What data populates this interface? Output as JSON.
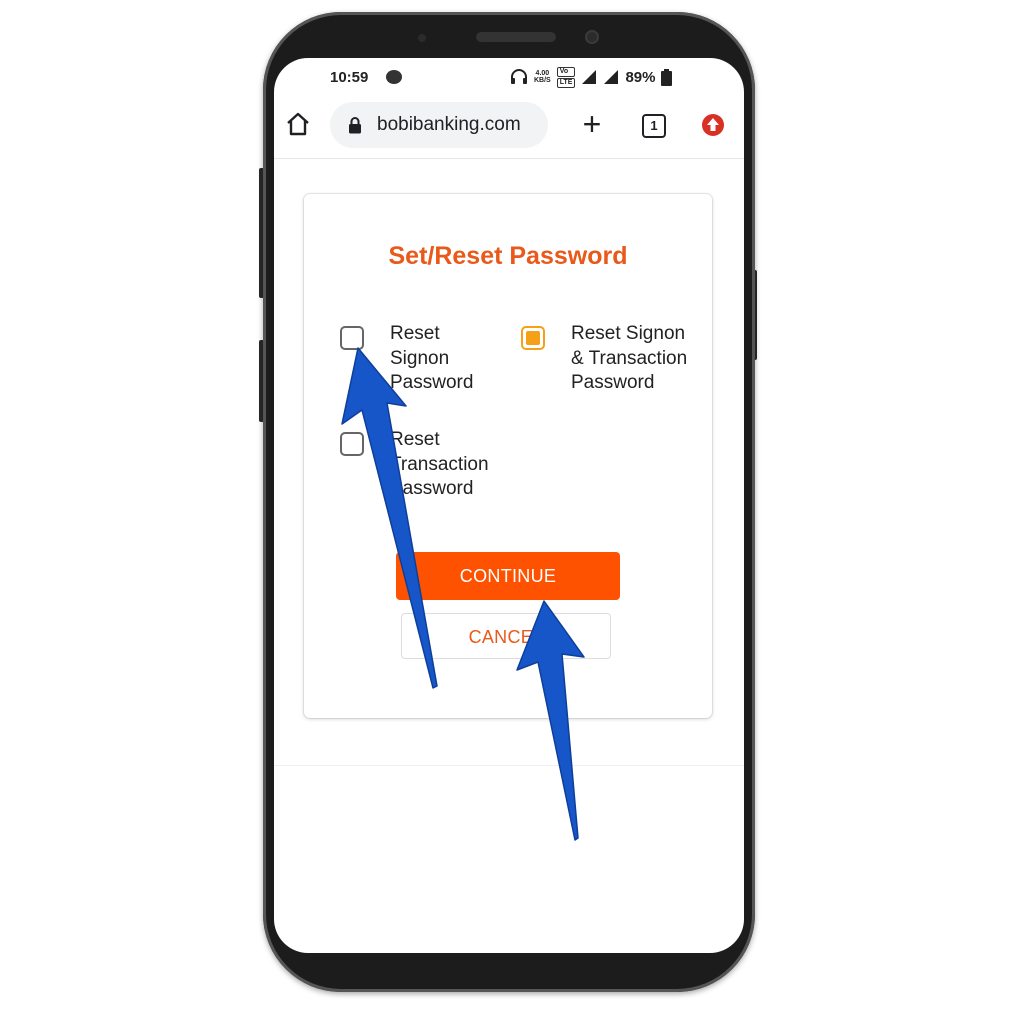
{
  "statusbar": {
    "time": "10:59",
    "speed_top": "4.00",
    "speed_unit": "KB/S",
    "lte_top": "Vo",
    "lte_bottom": "LTE",
    "battery": "89%",
    "icons": [
      "chat-icon",
      "headphones-icon",
      "signal-icon",
      "signal-icon",
      "battery-icon"
    ]
  },
  "browser": {
    "url": "bobibanking.com",
    "tab_count": "1",
    "icons": [
      "home-icon",
      "lock-icon",
      "plus-icon",
      "tabs-icon",
      "menu-update-icon"
    ],
    "menu_badge_color": "#d93025"
  },
  "dialog": {
    "title": "Set/Reset Password",
    "options": [
      {
        "label": "Reset Signon Password",
        "checked": false
      },
      {
        "label": "Reset Signon & Transaction Password",
        "checked": true
      },
      {
        "label": "Reset Transaction Password",
        "checked": false
      }
    ],
    "continue_label": "CONTINUE",
    "cancel_label": "CANCEL"
  },
  "colors": {
    "accent": "#fe5200",
    "title": "#e8591a",
    "checkbox_checked": "#f4a018",
    "annotation_arrow": "#1656c8"
  }
}
